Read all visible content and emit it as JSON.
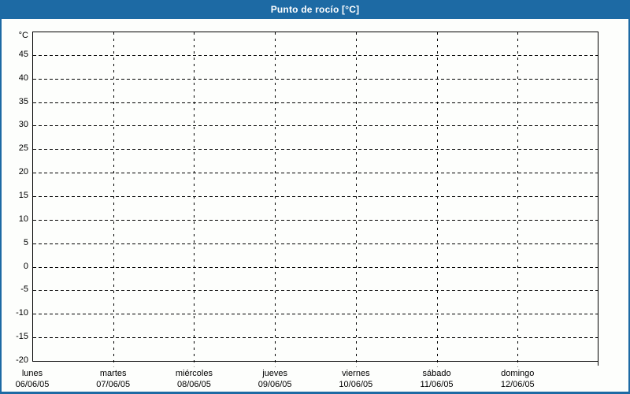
{
  "header": {
    "title": "Punto de rocío [°C]"
  },
  "colors": {
    "accent": "#1d6aa4",
    "grid": "#000000",
    "background": "#fdfefc",
    "title_text": "#ffffff",
    "label_text": "#000000"
  },
  "chart_data": {
    "type": "line",
    "title": "Punto de rocío [°C]",
    "ylabel": "°C",
    "ylim": [
      -20,
      50
    ],
    "ytick_step": 5,
    "yticks": [
      45,
      40,
      35,
      30,
      25,
      20,
      15,
      10,
      5,
      0,
      -5,
      -10,
      -15,
      -20
    ],
    "categories": [
      {
        "day": "lunes",
        "date": "06/06/05"
      },
      {
        "day": "martes",
        "date": "07/06/05"
      },
      {
        "day": "miércoles",
        "date": "08/06/05"
      },
      {
        "day": "jueves",
        "date": "09/06/05"
      },
      {
        "day": "viernes",
        "date": "10/06/05"
      },
      {
        "day": "sábado",
        "date": "11/06/05"
      },
      {
        "day": "domingo",
        "date": "12/06/05"
      }
    ],
    "series": [],
    "grid": "dashed",
    "legend": "none"
  }
}
